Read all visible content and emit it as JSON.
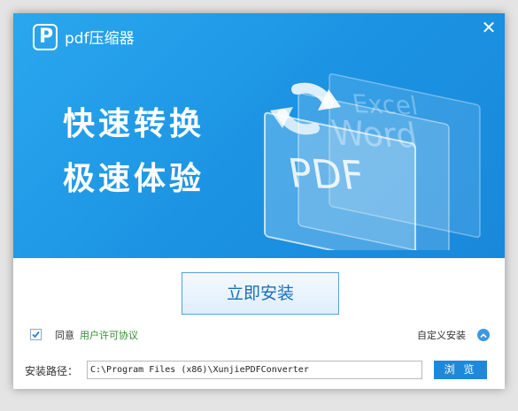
{
  "window": {
    "app_title": "pdf压缩器",
    "logo_letter": "P",
    "close_label": "✕"
  },
  "banner": {
    "slogan_line1": "快速转换",
    "slogan_line2": "极速体验",
    "doc_labels": [
      "PDF",
      "Word",
      "Excel"
    ]
  },
  "actions": {
    "install_label": "立即安装",
    "agree_checked": true,
    "agree_text": "同意",
    "license_link": "用户许可协议",
    "custom_install_label": "自定义安装"
  },
  "path": {
    "label": "安装路径：",
    "value": "C:\\Program Files (x86)\\XunjiePDFConverter",
    "browse_label": "浏 览"
  },
  "colors": {
    "banner_blue": "#1b92e2",
    "accent_blue": "#1f88d9",
    "link_green": "#2f8f2f"
  }
}
